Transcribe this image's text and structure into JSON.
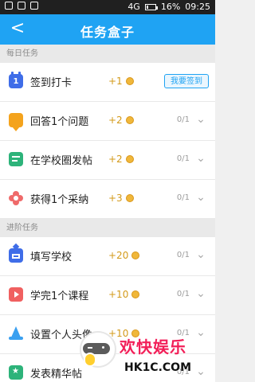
{
  "status_bar": {
    "battery_percent_text": "16%",
    "time": "09:25",
    "signal_label": "4G",
    "battery_level": 0.16
  },
  "topbar": {
    "title": "任务盒子",
    "back_glyph": "<"
  },
  "sections": [
    {
      "title": "每日任务",
      "items": [
        {
          "icon": "calendar-icon",
          "calendar_day": "1",
          "label": "签到打卡",
          "points": "+1",
          "action_label": "我要签到"
        },
        {
          "icon": "chat-bubble-icon",
          "label": "回答1个问题",
          "points": "+2",
          "progress": "0/1"
        },
        {
          "icon": "post-icon",
          "label": "在学校圈发帖",
          "points": "+2",
          "progress": "0/1"
        },
        {
          "icon": "flower-icon",
          "label": "获得1个采纳",
          "points": "+3",
          "progress": "0/1"
        }
      ]
    },
    {
      "title": "进阶任务",
      "items": [
        {
          "icon": "school-icon",
          "label": "填写学校",
          "points": "+20",
          "progress": "0/1"
        },
        {
          "icon": "play-course-icon",
          "label": "学完1个课程",
          "points": "+10",
          "progress": "0/1"
        },
        {
          "icon": "wizard-hat-icon",
          "label": "设置个人头像",
          "points": "+10",
          "progress": "0/1"
        },
        {
          "icon": "bookmark-star-icon",
          "label": "发表精华帖",
          "points": "",
          "progress": "0/1"
        }
      ]
    }
  ],
  "watermark": {
    "title": "欢快娱乐",
    "subtitle": "HK1C.COM"
  },
  "colors": {
    "topbar": "#1fa3f3",
    "accent_blue": "#1fa3f3",
    "points_gold": "#d39a1a",
    "watermark_pink": "#f21f58"
  }
}
